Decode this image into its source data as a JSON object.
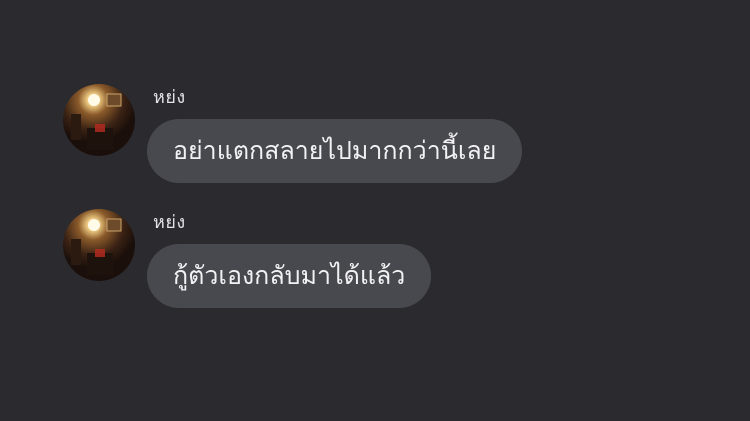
{
  "messages": [
    {
      "sender": "หย่ง",
      "text": "อย่าแตกสลายไปมากกว่านี้เลย",
      "avatar_icon": "profile-photo-avatar"
    },
    {
      "sender": "หย่ง",
      "text": "กู้ตัวเองกลับมาได้แล้ว",
      "avatar_icon": "profile-photo-avatar"
    }
  ],
  "colors": {
    "background": "#2a2a2f",
    "bubble": "#48484f",
    "text": "#f2f2f4"
  }
}
